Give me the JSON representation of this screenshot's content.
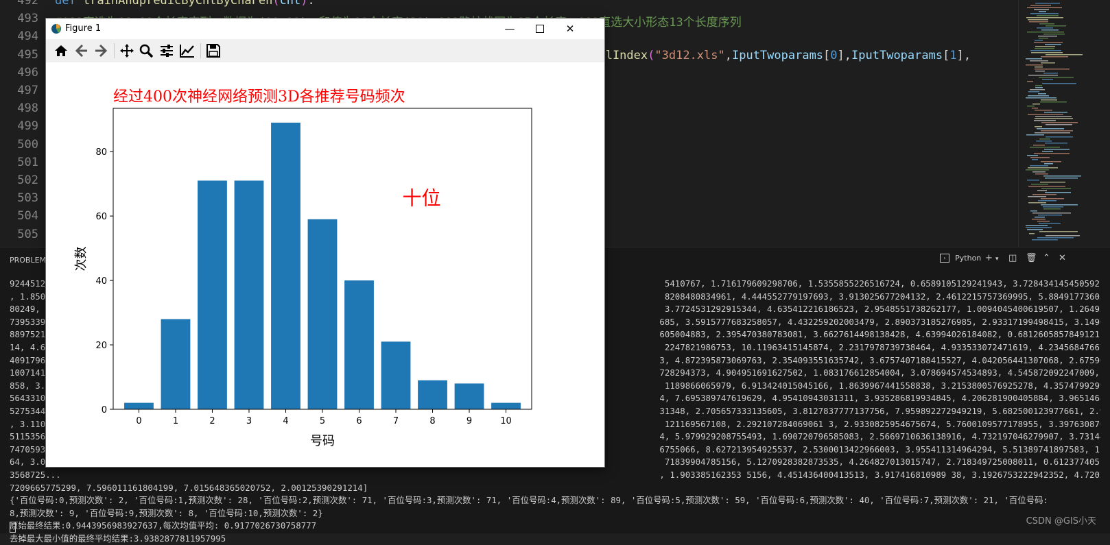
{
  "editor": {
    "lines": [
      {
        "num": "492",
        "code": "def trainAndpredicByCntByChaFen(cnt):"
      },
      {
        "num": "493",
        "code": "    #012直选为10x10个长度序列，数据为(00,99)，和值为10个长度(30),012路柱状图为15个长度，012直选大小形态13个长度序列"
      },
      {
        "num": "494",
        "code": ""
      },
      {
        "num": "495",
        "code": "yColIndex(\"3d12.xls\",IputTwoparams[0],IputTwoparams[1],"
      },
      {
        "num": "496",
        "code": ""
      },
      {
        "num": "497",
        "code": ""
      },
      {
        "num": "498",
        "code": ""
      },
      {
        "num": "499",
        "code": ""
      },
      {
        "num": "500",
        "code": ""
      },
      {
        "num": "501",
        "code": ""
      },
      {
        "num": "502",
        "code": ""
      },
      {
        "num": "503",
        "code": ""
      },
      {
        "num": "504",
        "code": ""
      },
      {
        "num": "505",
        "code": ""
      }
    ],
    "line493_comment": "#012直选为10x10个长度序列，数据为(00,99)，和值为10个长度(30),012路柱状图为15个长度，012直选大小形态13个长度序列",
    "line495_fn": "yColIndex",
    "line495_str": "\"3d12.xls\"",
    "line495_arg1": "IputTwoparams",
    "line495_idx0": "0",
    "line495_arg2": "IputTwoparams",
    "line495_idx1": "1"
  },
  "panel": {
    "tab_label": "PROBLEMS",
    "shell_label": "Python",
    "terminal_lines": [
      "92445124...                                                                                                                     5410767, 1.716179609298706, 1.5355855226516724, 0.6589105129241943, 3.728434145450592, 3.2203899621963",
      ", 1.8500...                                                                                                                     8208480834961, 4.444552779197693, 3.913025677204132, 2.4612215757369995, 5.884917736053467, 6.188909053",
      "80249, 2...                                                                                                                     3.7724531292915344, 4.635412216186523, 2.9548551738262177, 1.0094045400619507, 1.2649593353271484, 4.0",
      "7395339...                                                                                                                     685, 3.5915777683258057, 4.432259202003479, 2.890373185276985, 2.93317199498415, 3.149664878845215, 5.",
      "8897521...                                                                                                                     605004883, 2.395470380783081, 3.6627614498138428, 4.63994026184082, 0.6812605857849121, 4.4534556865692",
      "14, 4.67...                                                                                                                     2247821986753, 10.11963415145874, 2.2317978739738464, 4.933533072471619, 4.234568476676941, 6.3594894",
      "4091796...                                                                                                                     3, 4.872395873069763, 2.354093551635742, 3.6757407188415527, 4.042056441307068, 2.675904780626297, 3.0",
      "1007141...                                                                                                                     728294373, 4.904951691627502, 1.083176612854004, 3.078694574534893, 4.545872092247009, 1.2001327276229",
      "858, 3.3...                                                                                                                     1189866065979, 6.913424015045166, 1.8639967441558838, 3.2153800576925278, 4.357479929924011, 4.1634931",
      "5643310...                                                                                                                     4, 7.695389747619629, 4.95410943031311, 3.935286819934845, 4.206281900405884, 3.965146839618683, 1.840",
      "5275344...                                                                                                                     31348, 2.705657333135605, 3.8127837777137756, 7.959892272949219, 5.682500123977661, 2.9363796189427376",
      ", 3.1100...                                                                                                                     121169567108, 2.292107284069061 3, 2.9330825954675674, 5.7600109577178955, 3.3976308703422546, 1.775166",
      "5115356...                                                                                                                     4, 5.979929208755493, 1.690720796585083, 2.5669710636138916, 4.732197046279907, 3.731442093849182, 0.9",
      "7470593...                                                                                                                     6755066, 8.627213954925537, 2.5300013422966003, 3.955411314964294, 5.51389741897583, 1.98821055889129",
      "64, 3.07...                                                                                                                     71839904785156, 5.1270928382873535, 4.264827013015747, 2.718349725008011, 0.612377405166626, 5.8206267",
      "3568725...                                                                                                                     , 1.903385162353 5156, 4.451436400413513, 3.917416810989 38, 3.1926753222942352, 4.720288991928101, 2.43",
      "7209665775299, 7.596011161804199, 7.015648365020752, 2.00125390291214]",
      "{'百位号码:0,预测次数': 2, '百位号码:1,预测次数': 28, '百位号码:2,预测次数': 71, '百位号码:3,预测次数': 71, '百位号码:4,预测次数': 89, '百位号码:5,预测次数': 59, '百位号码:6,预测次数': 40, '百位号码:7,预测次数': 21, '百位号码:",
      "8,预测次数': 9, '百位号码:9,预测次数': 8, '百位号码:10,预测次数': 2}",
      "原始最终结果:0.9443956983927637,每次均值平均: 0.9177026730758777",
      "去掉最大最小值的最终平均结果:3.9382877811957995"
    ],
    "watermark": "CSDN @GIS小天"
  },
  "figure": {
    "window_title": "Figure 1",
    "toolbar_icons": [
      "home-icon",
      "back-arrow-icon",
      "forward-arrow-icon",
      "pan-icon",
      "zoom-icon",
      "configure-subplots-icon",
      "edit-axis-icon",
      "save-icon"
    ]
  },
  "chart_data": {
    "type": "bar",
    "title": "经过400次神经网络预测3D各推荐号码频次",
    "xlabel": "号码",
    "ylabel": "次数",
    "annotation": "十位",
    "categories": [
      "0",
      "1",
      "2",
      "3",
      "4",
      "5",
      "6",
      "7",
      "8",
      "9",
      "10"
    ],
    "values": [
      2,
      28,
      71,
      71,
      89,
      59,
      40,
      21,
      9,
      8,
      2
    ],
    "yticks": [
      0,
      20,
      40,
      60,
      80
    ],
    "ylim": [
      0,
      93.45
    ],
    "bar_color": "#1f77b4",
    "title_color": "#ff0000",
    "annotation_color": "#ff0000",
    "grid": false,
    "legend": "none"
  }
}
